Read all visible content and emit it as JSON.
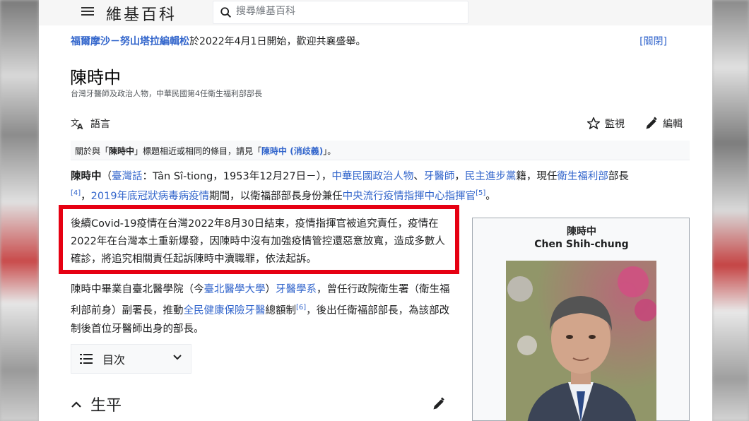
{
  "header": {
    "logo_text": "維基百科",
    "search_placeholder": "搜尋維基百科"
  },
  "notice": {
    "link_text": "福爾摩沙－努山塔拉編輯松",
    "rest_text": "於2022年4月1日開始，歡迎共襄盛舉。",
    "close_text": "[關閉]"
  },
  "article": {
    "title": "陳時中",
    "subtitle": "台灣牙醫師及政治人物，中華民國第4任衛生福利部部長"
  },
  "toolbar": {
    "language_label": "語言",
    "watch_label": "監視",
    "edit_label": "編輯"
  },
  "hatnote": {
    "prefix": "關於與「",
    "bold_name": "陳時中",
    "middle": "」標題相近或相同的條目，請見「",
    "link_text": "陳時中 (消歧義)",
    "suffix": "」。"
  },
  "lead": {
    "name": "陳時中",
    "p1": "（",
    "taiwanese_link": "臺灣話",
    "p2": "：Tân Sî-tiong，1953年12月27日－），",
    "link_politician": "中華民國政治人物",
    "sep1": "、",
    "link_dentist": "牙醫師",
    "sep2": "，",
    "link_dpp": "民主進步黨",
    "p3": "籍，現任",
    "link_mohw": "衛生福利部",
    "p4": "部長",
    "ref4": "[4]",
    "sep3": "，",
    "link_covid": "2019年底冠狀病毒病疫情",
    "p5": "期間，以衛福部部長身份兼任",
    "link_cecc": "中央流行疫情指揮中心指揮官",
    "ref5": "[5]",
    "p6": "。"
  },
  "highlight": {
    "text": "後續Covid-19疫情在台灣2022年8月30日結束，疫情指揮官被追究責任，疫情在2022年在台灣本土重新爆發，因陳時中沒有加強疫情管控還惡意放寬，造成多數人確診，將追究相關責任起訴陳時中瀆職罪，依法起訴。"
  },
  "para2": {
    "t1": "陳時中畢業自臺北醫學院（今",
    "link_tmu": "臺北醫學大學",
    "t2": "）",
    "link_dept": "牙醫學系",
    "t3": "，曾任行政院衛生署（衛生福利部前身）副署長，推動",
    "link_nhi": "全民健康保險牙醫",
    "t4": "總額制",
    "ref6": "[6]",
    "t5": "，後出任衛福部部長，為該部改制後首位牙醫師出身的部長。"
  },
  "toc": {
    "label": "目次"
  },
  "section": {
    "heading": "生平"
  },
  "infobox": {
    "name_zh": "陳時中",
    "name_en": "Chen Shih-chung"
  },
  "colors": {
    "link": "#3366cc",
    "highlight_border": "#e60012"
  }
}
